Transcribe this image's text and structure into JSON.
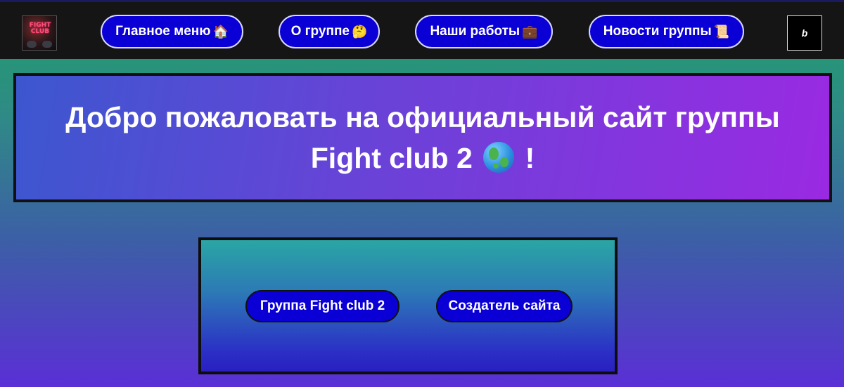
{
  "nav": {
    "logo_text": "FIGHT CLUB",
    "items": [
      {
        "label": "Главное меню",
        "emoji": "🏠"
      },
      {
        "label": "О группе",
        "emoji": "🤔"
      },
      {
        "label": "Наши работы",
        "emoji": "💼"
      },
      {
        "label": "Новости группы",
        "emoji": "📜"
      }
    ],
    "b_button": "b"
  },
  "welcome": {
    "line1": "Добро пожаловать на официальный сайт группы",
    "line2": "Fight club 2",
    "exclaim": "!",
    "icon": "globe-icon"
  },
  "links": {
    "group_button": "Группа Fight club 2",
    "creator_button": "Создатель сайта"
  },
  "colors": {
    "button_bg": "#0a00d6",
    "navbar_bg": "#151515"
  }
}
